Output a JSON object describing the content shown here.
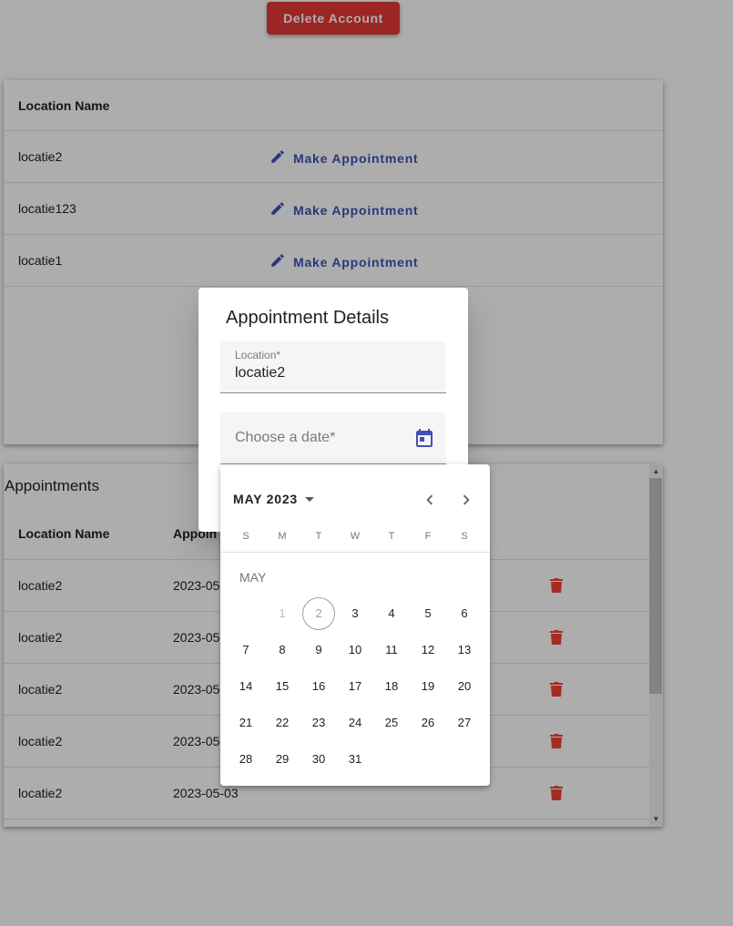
{
  "header": {
    "delete_label": "Delete Account"
  },
  "locations": {
    "column_header": "Location Name",
    "action_label": "Make Appointment",
    "rows": [
      {
        "name": "locatie2"
      },
      {
        "name": "locatie123"
      },
      {
        "name": "locatie1"
      }
    ]
  },
  "appointments": {
    "title": "Appointments",
    "columns": [
      "Location Name",
      "Appoin"
    ],
    "rows": [
      {
        "location": "locatie2",
        "date": "2023-05"
      },
      {
        "location": "locatie2",
        "date": "2023-05"
      },
      {
        "location": "locatie2",
        "date": "2023-05"
      },
      {
        "location": "locatie2",
        "date": "2023-05"
      },
      {
        "location": "locatie2",
        "date": "2023-05-03"
      }
    ]
  },
  "dialog": {
    "title": "Appointment Details",
    "location_label": "Location*",
    "location_value": "locatie2",
    "date_placeholder": "Choose a date*"
  },
  "datepicker": {
    "period_label": "MAY 2023",
    "month_label": "MAY",
    "weekdays": [
      "S",
      "M",
      "T",
      "W",
      "T",
      "F",
      "S"
    ],
    "first_weekday_offset": 1,
    "days": [
      "1",
      "2",
      "3",
      "4",
      "5",
      "6",
      "7",
      "8",
      "9",
      "10",
      "11",
      "12",
      "13",
      "14",
      "15",
      "16",
      "17",
      "18",
      "19",
      "20",
      "21",
      "22",
      "23",
      "24",
      "25",
      "26",
      "27",
      "28",
      "29",
      "30",
      "31"
    ],
    "disabled_days": [
      "1"
    ],
    "today": "2"
  },
  "icons": {
    "edit": "pencil-icon",
    "calendar": "calendar-icon",
    "delete": "trash-icon",
    "prev": "chevron-left-icon",
    "next": "chevron-right-icon"
  },
  "colors": {
    "primary": "#3f51b5",
    "warn": "#e53935",
    "backdrop": "rgba(0,0,0,0.32)"
  }
}
